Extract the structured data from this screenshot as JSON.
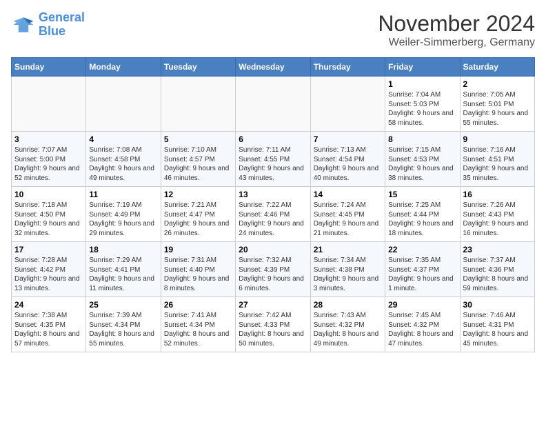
{
  "logo": {
    "line1": "General",
    "line2": "Blue"
  },
  "title": "November 2024",
  "location": "Weiler-Simmerberg, Germany",
  "days_of_week": [
    "Sunday",
    "Monday",
    "Tuesday",
    "Wednesday",
    "Thursday",
    "Friday",
    "Saturday"
  ],
  "weeks": [
    [
      {
        "day": "",
        "info": ""
      },
      {
        "day": "",
        "info": ""
      },
      {
        "day": "",
        "info": ""
      },
      {
        "day": "",
        "info": ""
      },
      {
        "day": "",
        "info": ""
      },
      {
        "day": "1",
        "info": "Sunrise: 7:04 AM\nSunset: 5:03 PM\nDaylight: 9 hours and 58 minutes."
      },
      {
        "day": "2",
        "info": "Sunrise: 7:05 AM\nSunset: 5:01 PM\nDaylight: 9 hours and 55 minutes."
      }
    ],
    [
      {
        "day": "3",
        "info": "Sunrise: 7:07 AM\nSunset: 5:00 PM\nDaylight: 9 hours and 52 minutes."
      },
      {
        "day": "4",
        "info": "Sunrise: 7:08 AM\nSunset: 4:58 PM\nDaylight: 9 hours and 49 minutes."
      },
      {
        "day": "5",
        "info": "Sunrise: 7:10 AM\nSunset: 4:57 PM\nDaylight: 9 hours and 46 minutes."
      },
      {
        "day": "6",
        "info": "Sunrise: 7:11 AM\nSunset: 4:55 PM\nDaylight: 9 hours and 43 minutes."
      },
      {
        "day": "7",
        "info": "Sunrise: 7:13 AM\nSunset: 4:54 PM\nDaylight: 9 hours and 40 minutes."
      },
      {
        "day": "8",
        "info": "Sunrise: 7:15 AM\nSunset: 4:53 PM\nDaylight: 9 hours and 38 minutes."
      },
      {
        "day": "9",
        "info": "Sunrise: 7:16 AM\nSunset: 4:51 PM\nDaylight: 9 hours and 35 minutes."
      }
    ],
    [
      {
        "day": "10",
        "info": "Sunrise: 7:18 AM\nSunset: 4:50 PM\nDaylight: 9 hours and 32 minutes."
      },
      {
        "day": "11",
        "info": "Sunrise: 7:19 AM\nSunset: 4:49 PM\nDaylight: 9 hours and 29 minutes."
      },
      {
        "day": "12",
        "info": "Sunrise: 7:21 AM\nSunset: 4:47 PM\nDaylight: 9 hours and 26 minutes."
      },
      {
        "day": "13",
        "info": "Sunrise: 7:22 AM\nSunset: 4:46 PM\nDaylight: 9 hours and 24 minutes."
      },
      {
        "day": "14",
        "info": "Sunrise: 7:24 AM\nSunset: 4:45 PM\nDaylight: 9 hours and 21 minutes."
      },
      {
        "day": "15",
        "info": "Sunrise: 7:25 AM\nSunset: 4:44 PM\nDaylight: 9 hours and 18 minutes."
      },
      {
        "day": "16",
        "info": "Sunrise: 7:26 AM\nSunset: 4:43 PM\nDaylight: 9 hours and 16 minutes."
      }
    ],
    [
      {
        "day": "17",
        "info": "Sunrise: 7:28 AM\nSunset: 4:42 PM\nDaylight: 9 hours and 13 minutes."
      },
      {
        "day": "18",
        "info": "Sunrise: 7:29 AM\nSunset: 4:41 PM\nDaylight: 9 hours and 11 minutes."
      },
      {
        "day": "19",
        "info": "Sunrise: 7:31 AM\nSunset: 4:40 PM\nDaylight: 9 hours and 8 minutes."
      },
      {
        "day": "20",
        "info": "Sunrise: 7:32 AM\nSunset: 4:39 PM\nDaylight: 9 hours and 6 minutes."
      },
      {
        "day": "21",
        "info": "Sunrise: 7:34 AM\nSunset: 4:38 PM\nDaylight: 9 hours and 3 minutes."
      },
      {
        "day": "22",
        "info": "Sunrise: 7:35 AM\nSunset: 4:37 PM\nDaylight: 9 hours and 1 minute."
      },
      {
        "day": "23",
        "info": "Sunrise: 7:37 AM\nSunset: 4:36 PM\nDaylight: 8 hours and 59 minutes."
      }
    ],
    [
      {
        "day": "24",
        "info": "Sunrise: 7:38 AM\nSunset: 4:35 PM\nDaylight: 8 hours and 57 minutes."
      },
      {
        "day": "25",
        "info": "Sunrise: 7:39 AM\nSunset: 4:34 PM\nDaylight: 8 hours and 55 minutes."
      },
      {
        "day": "26",
        "info": "Sunrise: 7:41 AM\nSunset: 4:34 PM\nDaylight: 8 hours and 52 minutes."
      },
      {
        "day": "27",
        "info": "Sunrise: 7:42 AM\nSunset: 4:33 PM\nDaylight: 8 hours and 50 minutes."
      },
      {
        "day": "28",
        "info": "Sunrise: 7:43 AM\nSunset: 4:32 PM\nDaylight: 8 hours and 49 minutes."
      },
      {
        "day": "29",
        "info": "Sunrise: 7:45 AM\nSunset: 4:32 PM\nDaylight: 8 hours and 47 minutes."
      },
      {
        "day": "30",
        "info": "Sunrise: 7:46 AM\nSunset: 4:31 PM\nDaylight: 8 hours and 45 minutes."
      }
    ]
  ]
}
